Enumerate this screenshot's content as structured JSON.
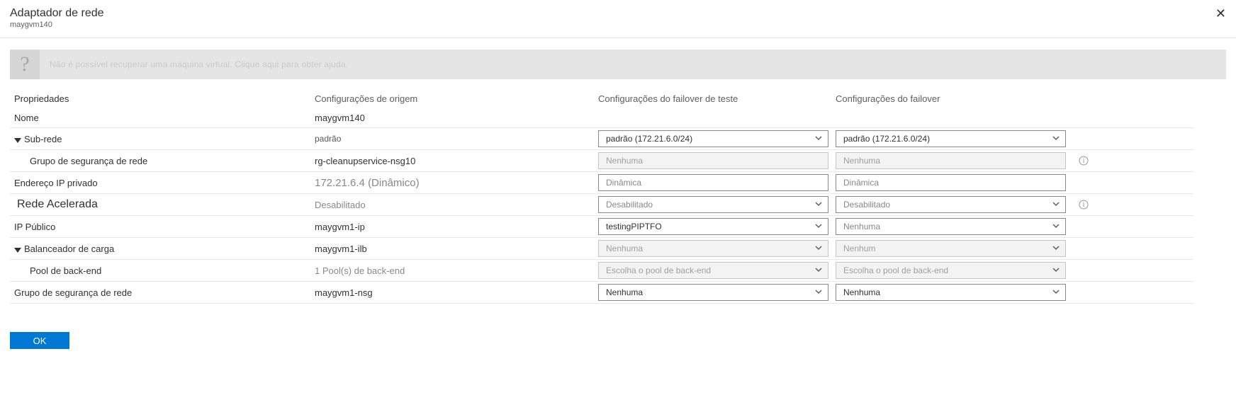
{
  "header": {
    "title": "Adaptador de rede",
    "subtitle": "maygvm140"
  },
  "banner": {
    "icon": "?",
    "text": "Não é possível recuperar uma máquina virtual. Clique aqui para obter ajuda."
  },
  "columns": {
    "props": "Propriedades",
    "source": "Configurações de origem",
    "test": "Configurações do failover de teste",
    "failover": "Configurações do failover"
  },
  "rows": {
    "name": {
      "label": "Nome",
      "source": "maygvm140"
    },
    "subnet": {
      "label": "Sub-rede",
      "source": "padrão",
      "test": "padrão (172.21.6.0/24)",
      "failover": "padrão (172.21.6.0/24)"
    },
    "nsg1": {
      "label": "Grupo de segurança de rede",
      "source": "rg-cleanupservice-nsg10",
      "test": "Nenhuma",
      "failover": "Nenhuma"
    },
    "privip": {
      "label": "Endereço IP privado",
      "source": "172.21.6.4 (Dinâmico)",
      "test": "Dinâmica",
      "failover": "Dinâmica"
    },
    "accel": {
      "label": "Rede Acelerada",
      "source": "Desabilitado",
      "test": "Desabilitado",
      "failover": "Desabilitado"
    },
    "pubip": {
      "label": "IP Público",
      "source": "maygvm1-ip",
      "test": "testingPIPTFO",
      "failover": "Nenhuma"
    },
    "lb": {
      "label": "Balanceador de carga",
      "source": "maygvm1-ilb",
      "test": "Nenhuma",
      "failover": "Nenhum"
    },
    "bepool": {
      "label": "Pool de back-end",
      "source": "1 Pool(s) de back-end",
      "test": "Escolha o pool de back-end",
      "failover": "Escolha o pool de back-end"
    },
    "nsg2": {
      "label": "Grupo de segurança de rede",
      "source": "maygvm1-nsg",
      "test": "Nenhuma",
      "failover": "Nenhuma"
    }
  },
  "buttons": {
    "ok": "OK"
  }
}
